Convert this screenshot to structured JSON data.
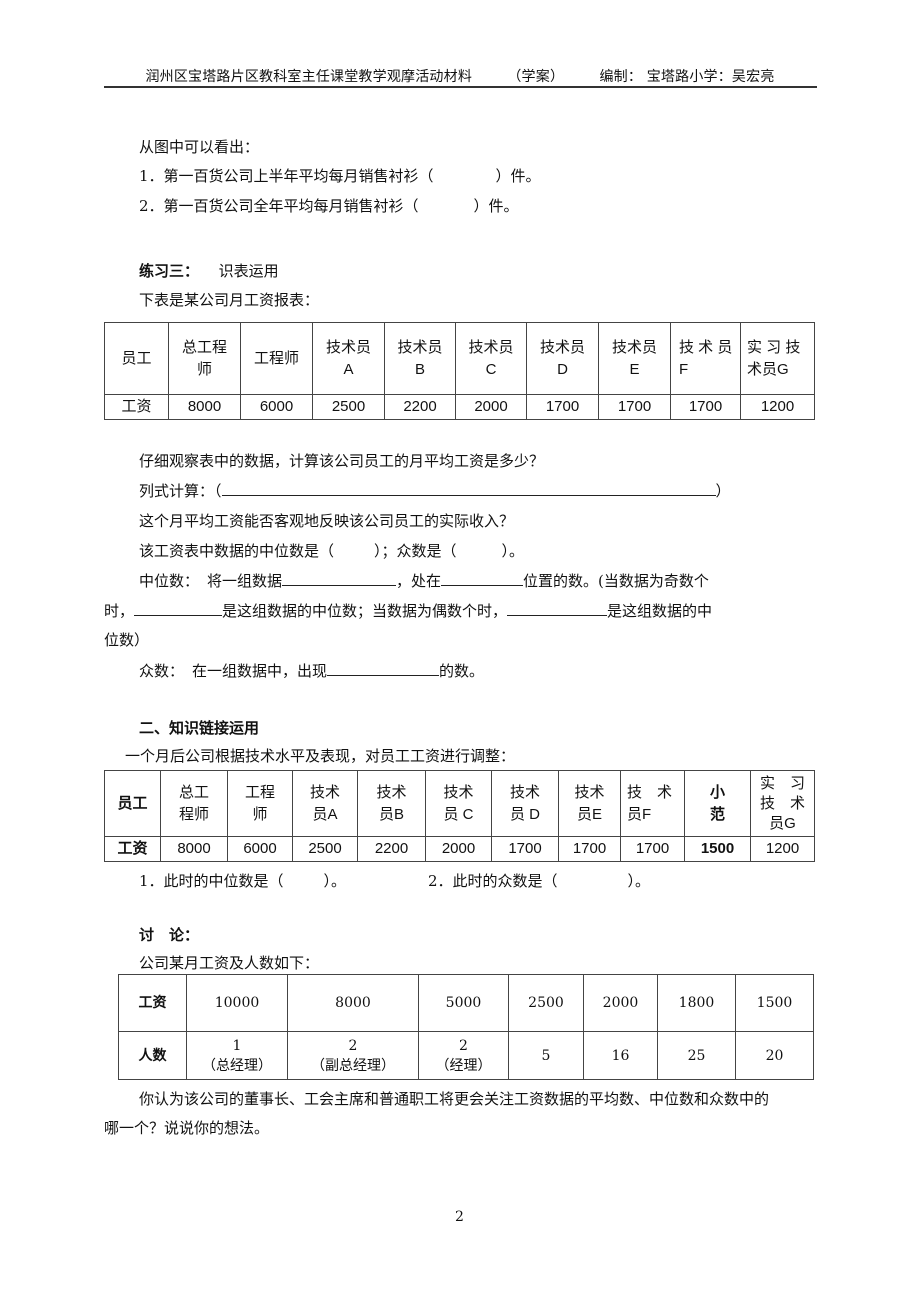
{
  "header": {
    "title": "润州区宝塔路片区教科室主任课堂教学观摩活动材料",
    "type": "（学案）",
    "editor": "编制：  宝塔路小学：吴宏亮"
  },
  "intro": {
    "lead": "从图中可以看出：",
    "q1_prefix": "1．第一百货公司上半年平均每月销售衬衫（",
    "q1_suffix": "）件。",
    "q2_prefix": "2．第一百货公司全年平均每月销售衬衫（",
    "q2_suffix": "）件。"
  },
  "exercise3": {
    "title": "练习三：",
    "subtitle": "识表运用",
    "desc": "下表是某公司月工资报表：",
    "table": {
      "row1_label": "员工",
      "row2_label": "工资",
      "headers": [
        "总工程师",
        "工程师",
        "技术员A",
        "技术员B",
        "技术员C",
        "技术员D",
        "技术员E",
        "技术员F",
        "实习技术员G"
      ],
      "header_lines": [
        [
          "总工程",
          "师"
        ],
        [
          "工程师"
        ],
        [
          "技术员",
          "A"
        ],
        [
          "技术员",
          "B"
        ],
        [
          "技术员",
          "C"
        ],
        [
          "技术员",
          "D"
        ],
        [
          "技术员",
          "E"
        ],
        [
          "技 术 员",
          "F"
        ],
        [
          "实 习 技",
          "术员G"
        ]
      ],
      "salaries": [
        "8000",
        "6000",
        "2500",
        "2200",
        "2000",
        "1700",
        "1700",
        "1700",
        "1200"
      ]
    },
    "q_avg": "仔细观察表中的数据，计算该公司员工的月平均工资是多少？",
    "calc_prefix": "列式计算：（",
    "calc_suffix": "）",
    "q_reflect": "这个月平均工资能否客观地反映该公司员工的实际收入？",
    "q_median_prefix": "该工资表中数据的中位数是（",
    "q_median_mid": "）；众数是（",
    "q_median_suffix": "）。",
    "median_def": {
      "label": "中位数：",
      "p1": "将一组数据",
      "p2": "，处在",
      "p3": "位置的数。(当数据为奇数个",
      "p4": "时，",
      "p5": "是这组数据的中位数；当数据为偶数个时，",
      "p6": "是这组数据的中",
      "p7": "位数）"
    },
    "mode_def": {
      "label": "众数：",
      "p1": "在一组数据中，出现",
      "p2": "的数。"
    }
  },
  "section2": {
    "title": "二、知识链接运用",
    "desc": "一个月后公司根据技术水平及表现，对员工工资进行调整：",
    "table": {
      "row1_label": "员工",
      "row2_label": "工资",
      "header_lines": [
        [
          "总工",
          "程师"
        ],
        [
          "工程",
          "师"
        ],
        [
          "技术",
          "员A"
        ],
        [
          "技术",
          "员B"
        ],
        [
          "技术",
          "员 C"
        ],
        [
          "技术",
          "员 D"
        ],
        [
          "技术",
          "员E"
        ],
        [
          "技　术",
          "员F"
        ],
        [
          "小",
          "范"
        ],
        [
          "实　习",
          "技　术",
          "员G"
        ]
      ],
      "salaries": [
        "8000",
        "6000",
        "2500",
        "2200",
        "2000",
        "1700",
        "1700",
        "1700",
        "1500",
        "1200"
      ]
    },
    "q1_prefix": "1．此时的中位数是（",
    "q1_suffix": "）。",
    "q2_prefix": "2．此时的众数是（",
    "q2_suffix": "）。"
  },
  "discussion": {
    "title": "讨　论：",
    "desc": "公司某月工资及人数如下：",
    "table": {
      "row1_label": "工资",
      "row2_label": "人数",
      "salaries": [
        "10000",
        "8000",
        "5000",
        "2500",
        "2000",
        "1800",
        "1500"
      ],
      "counts": [
        "1",
        "2",
        "2",
        "5",
        "16",
        "25",
        "20"
      ],
      "roles": [
        "（总经理）",
        "（副总经理）",
        "（经理）",
        "",
        "",
        "",
        ""
      ]
    },
    "question_l1": "你认为该公司的董事长、工会主席和普通职工将更会关注工资数据的平均数、中位数和众数中的",
    "question_l2": "哪一个？说说你的想法。"
  },
  "footer": {
    "page_number": "2"
  }
}
